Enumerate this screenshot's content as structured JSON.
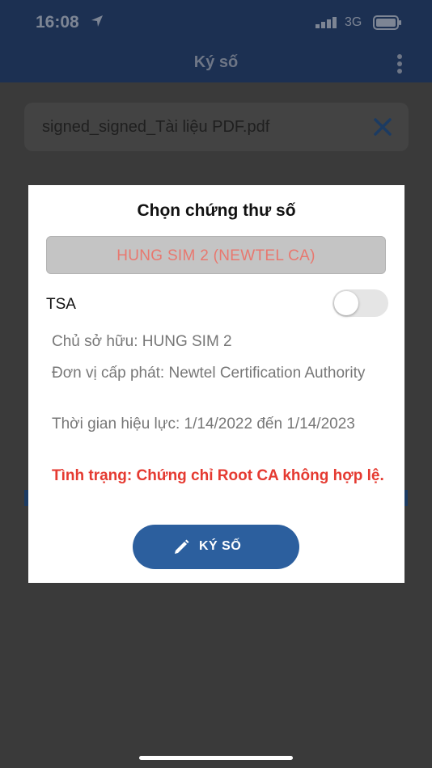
{
  "status_bar": {
    "time": "16:08",
    "network": "3G"
  },
  "header": {
    "title": "Ký số"
  },
  "file": {
    "name": "signed_signed_Tài liệu PDF.pdf"
  },
  "dialog": {
    "title": "Chọn chứng thư số",
    "certificate": "HUNG SIM 2 (NEWTEL CA)",
    "tsa_label": "TSA",
    "tsa_enabled": false,
    "owner": "Chủ sở hữu: HUNG SIM 2",
    "issuer": "Đơn vị cấp phát: Newtel Certification Authority",
    "validity": "Thời gian hiệu lực: 1/14/2022 đến 1/14/2023",
    "status": "Tình trạng: Chứng chỉ Root CA không hợp lệ.",
    "sign_button": "KÝ SỐ"
  },
  "colors": {
    "header_bg": "#1c3052",
    "accent": "#2c5f9e",
    "error": "#e53a31",
    "certificate_text": "#e8786f"
  },
  "icons": [
    "location-arrow-icon",
    "signal-icon",
    "battery-icon",
    "kebab-menu-icon",
    "close-icon",
    "pen-icon"
  ]
}
